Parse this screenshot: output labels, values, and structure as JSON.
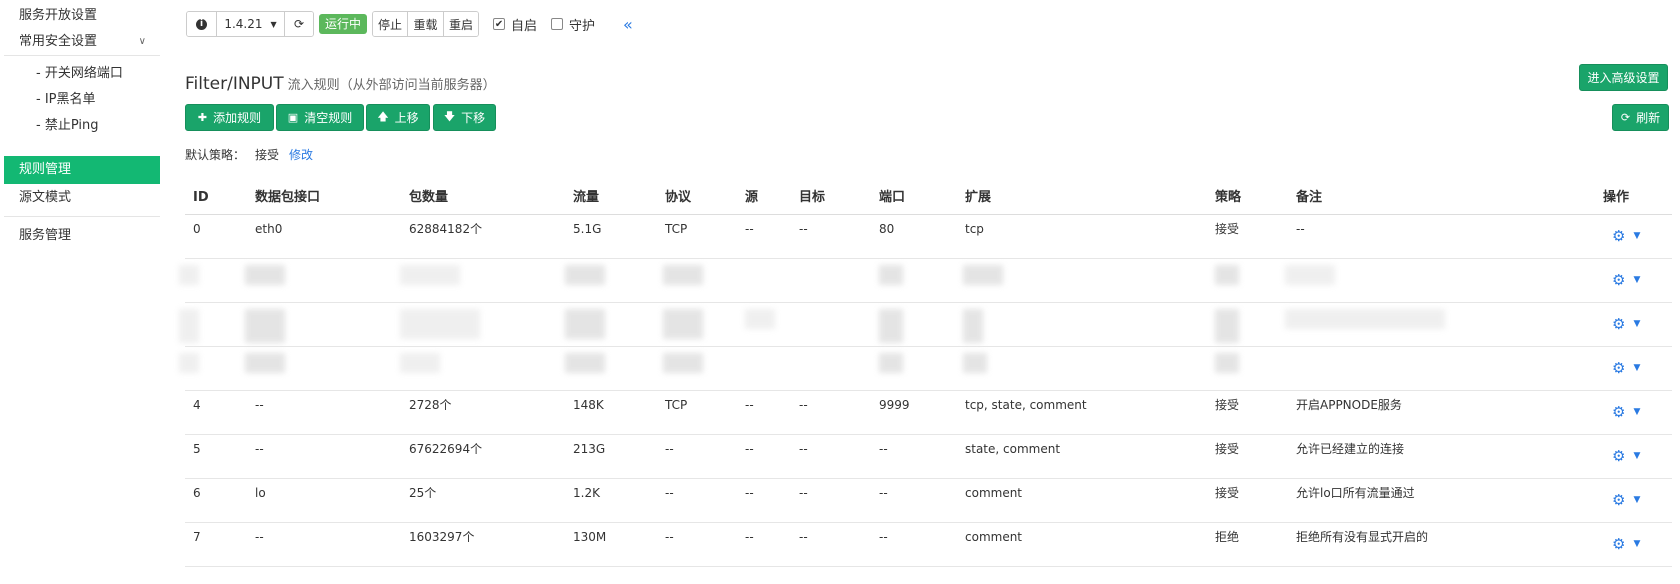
{
  "sidebar": {
    "items": [
      {
        "label": "服务开放设置"
      },
      {
        "label": "常用安全设置"
      },
      {
        "label": "- 开关网络端口"
      },
      {
        "label": "- IP黑名单"
      },
      {
        "label": "- 禁止Ping"
      },
      {
        "label": "规则管理"
      },
      {
        "label": "源文模式"
      },
      {
        "label": "服务管理"
      }
    ]
  },
  "toolbar": {
    "version": "1.4.21",
    "status": "运行中",
    "stop": "停止",
    "reload": "重载",
    "restart": "重启",
    "autostart": "自启",
    "guard": "守护",
    "autostart_checked": true,
    "guard_checked": false
  },
  "header": {
    "title": "Filter/INPUT",
    "subtitle": "流入规则（从外部访问当前服务器）",
    "advanced_button": "进入高级设置",
    "refresh_button": "刷新"
  },
  "actions": {
    "add": "添加规则",
    "clear": "清空规则",
    "up": "上移",
    "down": "下移"
  },
  "policy": {
    "label": "默认策略：",
    "value": "接受",
    "edit": "修改"
  },
  "table": {
    "columns": [
      "ID",
      "数据包接口",
      "包数量",
      "流量",
      "协议",
      "源",
      "目标",
      "端口",
      "扩展",
      "策略",
      "备注",
      "操作"
    ],
    "rows": [
      [
        "0",
        "eth0",
        "62884182个",
        "5.1G",
        "TCP",
        "--",
        "--",
        "80",
        "tcp",
        "接受",
        "--"
      ],
      [
        "4",
        "--",
        "2728个",
        "148K",
        "TCP",
        "--",
        "--",
        "9999",
        "tcp, state, comment",
        "接受",
        "开启APPNODE服务"
      ],
      [
        "5",
        "--",
        "67622694个",
        "213G",
        "--",
        "--",
        "--",
        "--",
        "state, comment",
        "接受",
        "允许已经建立的连接"
      ],
      [
        "6",
        "lo",
        "25个",
        "1.2K",
        "--",
        "--",
        "--",
        "--",
        "comment",
        "接受",
        "允许lo口所有流量通过"
      ],
      [
        "7",
        "--",
        "1603297个",
        "130M",
        "--",
        "--",
        "--",
        "--",
        "comment",
        "拒绝",
        "拒绝所有没有显式开启的"
      ]
    ]
  },
  "colors": {
    "accent": "#13b873",
    "button_green": "#1aa46a",
    "status_green": "#5cb85c",
    "link_blue": "#2a7ae2"
  }
}
